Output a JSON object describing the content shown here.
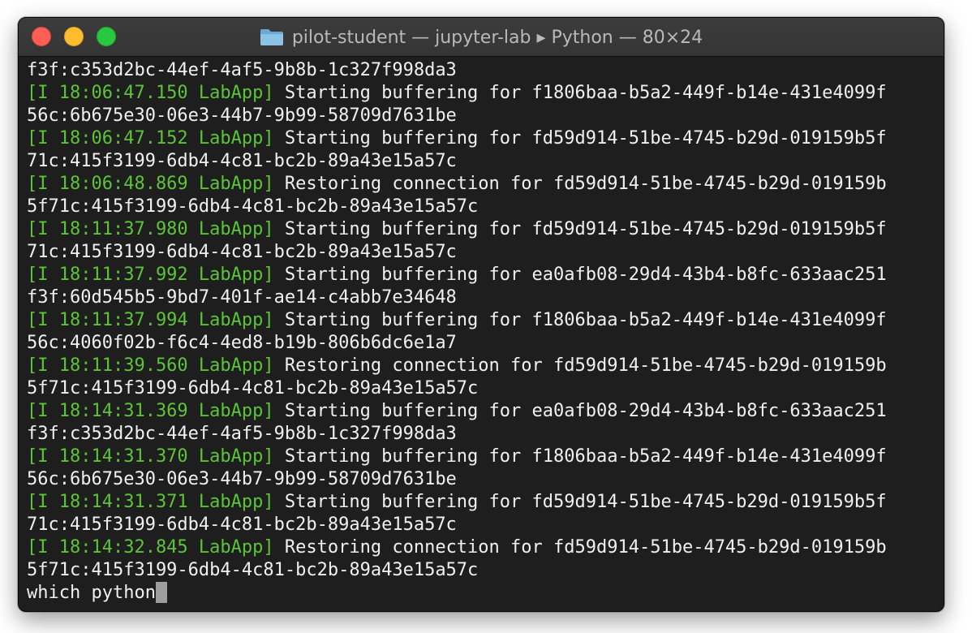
{
  "window": {
    "title": "pilot-student — jupyter-lab ▸ Python — 80×24",
    "folder_icon": "folder-icon"
  },
  "colors": {
    "log_prefix": "#5cc437",
    "text": "#f0f0f0",
    "background": "#1e1e1e",
    "close": "#fd5f57",
    "minimize": "#febc2e",
    "maximize": "#28c840"
  },
  "terminal": {
    "lines": [
      {
        "prefix": "",
        "text": "f3f:c353d2bc-44ef-4af5-9b8b-1c327f998da3"
      },
      {
        "prefix": "[I 18:06:47.150 LabApp]",
        "text": " Starting buffering for f1806baa-b5a2-449f-b14e-431e4099f"
      },
      {
        "prefix": "",
        "text": "56c:6b675e30-06e3-44b7-9b99-58709d7631be"
      },
      {
        "prefix": "[I 18:06:47.152 LabApp]",
        "text": " Starting buffering for fd59d914-51be-4745-b29d-019159b5f"
      },
      {
        "prefix": "",
        "text": "71c:415f3199-6db4-4c81-bc2b-89a43e15a57c"
      },
      {
        "prefix": "[I 18:06:48.869 LabApp]",
        "text": " Restoring connection for fd59d914-51be-4745-b29d-019159b"
      },
      {
        "prefix": "",
        "text": "5f71c:415f3199-6db4-4c81-bc2b-89a43e15a57c"
      },
      {
        "prefix": "[I 18:11:37.980 LabApp]",
        "text": " Starting buffering for fd59d914-51be-4745-b29d-019159b5f"
      },
      {
        "prefix": "",
        "text": "71c:415f3199-6db4-4c81-bc2b-89a43e15a57c"
      },
      {
        "prefix": "[I 18:11:37.992 LabApp]",
        "text": " Starting buffering for ea0afb08-29d4-43b4-b8fc-633aac251"
      },
      {
        "prefix": "",
        "text": "f3f:60d545b5-9bd7-401f-ae14-c4abb7e34648"
      },
      {
        "prefix": "[I 18:11:37.994 LabApp]",
        "text": " Starting buffering for f1806baa-b5a2-449f-b14e-431e4099f"
      },
      {
        "prefix": "",
        "text": "56c:4060f02b-f6c4-4ed8-b19b-806b6dc6e1a7"
      },
      {
        "prefix": "[I 18:11:39.560 LabApp]",
        "text": " Restoring connection for fd59d914-51be-4745-b29d-019159b"
      },
      {
        "prefix": "",
        "text": "5f71c:415f3199-6db4-4c81-bc2b-89a43e15a57c"
      },
      {
        "prefix": "[I 18:14:31.369 LabApp]",
        "text": " Starting buffering for ea0afb08-29d4-43b4-b8fc-633aac251"
      },
      {
        "prefix": "",
        "text": "f3f:c353d2bc-44ef-4af5-9b8b-1c327f998da3"
      },
      {
        "prefix": "[I 18:14:31.370 LabApp]",
        "text": " Starting buffering for f1806baa-b5a2-449f-b14e-431e4099f"
      },
      {
        "prefix": "",
        "text": "56c:6b675e30-06e3-44b7-9b99-58709d7631be"
      },
      {
        "prefix": "[I 18:14:31.371 LabApp]",
        "text": " Starting buffering for fd59d914-51be-4745-b29d-019159b5f"
      },
      {
        "prefix": "",
        "text": "71c:415f3199-6db4-4c81-bc2b-89a43e15a57c"
      },
      {
        "prefix": "[I 18:14:32.845 LabApp]",
        "text": " Restoring connection for fd59d914-51be-4745-b29d-019159b"
      },
      {
        "prefix": "",
        "text": "5f71c:415f3199-6db4-4c81-bc2b-89a43e15a57c"
      }
    ],
    "prompt_input": "which python"
  }
}
